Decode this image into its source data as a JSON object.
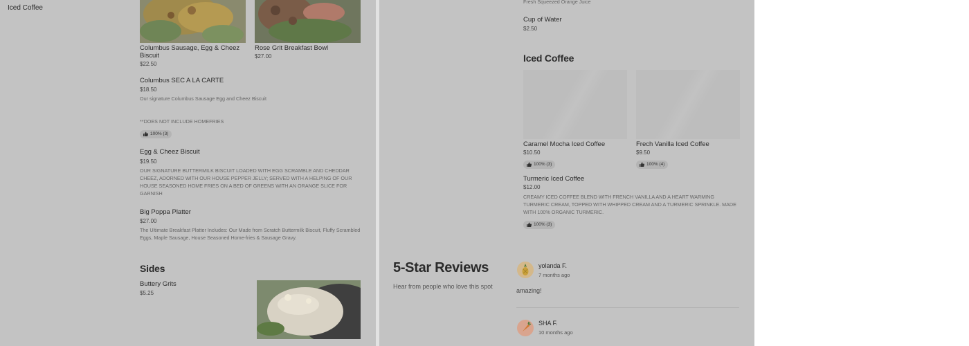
{
  "left_nav": {
    "active_item": "Iced Coffee"
  },
  "menu_left": {
    "items_top": [
      {
        "title": "Columbus Sausage, Egg & Cheez Biscuit",
        "price": "$22.50"
      },
      {
        "title": "Rose Grit Breakfast Bowl",
        "price": "$27.00"
      }
    ],
    "items": [
      {
        "title": "Columbus SEC A LA CARTE",
        "price": "$18.50",
        "desc1": "Our signature Columbus Sausage Egg and Cheez Biscuit",
        "desc2": "**DOES NOT INCLUDE HOMEFRIES",
        "rating": "100% (3)"
      },
      {
        "title": "Egg & Cheez Biscuit",
        "price": "$19.50",
        "desc": "OUR SIGNATURE BUTTERMILK BISCUIT LOADED WITH EGG SCRAMBLE AND CHEDDAR CHEEZ, ADORNED WITH OUR HOUSE PEPPER JELLY; SERVED WITH A HELPING OF OUR HOUSE SEASONED HOME FRIES ON A BED OF GREENS WITH AN ORANGE SLICE FOR GARNISH"
      },
      {
        "title": "Big Poppa Platter",
        "price": "$27.00",
        "desc": "The Ultimate Breakfast Platter Includes: Our Made from Scratch Buttermilk Biscuit, Fluffy Scrambled Eggs, Maple Sausage, House Seasoned Home-fries & Sausage Gravy."
      }
    ],
    "sides": {
      "heading": "Sides",
      "item_title": "Buttery Grits",
      "item_price": "$5.25"
    }
  },
  "menu_right": {
    "top_desc": "Fresh Squeezed Orange Juice",
    "water": {
      "title": "Cup of Water",
      "price": "$2.50"
    },
    "iced_coffee_heading": "Iced Coffee",
    "cards": [
      {
        "title": "Caramel Mocha Iced Coffee",
        "price": "$10.50",
        "rating": "100% (3)"
      },
      {
        "title": "Frech Vanilla Iced Coffee",
        "price": "$9.50",
        "rating": "100% (4)"
      }
    ],
    "turmeric": {
      "title": "Turmeric Iced Coffee",
      "price": "$12.00",
      "desc": "CREAMY ICED COFFEE BLEND WITH FRENCH VANILLA AND A HEART WARMING TURMERIC CREAM, TOPPED WITH WHIPPED CREAM AND A TURMERIC SPRINKLE. MADE WITH 100% ORGANIC TURMERIC.",
      "rating": "100% (3)"
    }
  },
  "reviews": {
    "heading": "5-Star Reviews",
    "subheading": "Hear from people who love this spot",
    "items": [
      {
        "name": "yolanda F.",
        "time": "7 months ago",
        "text": "amazing!"
      },
      {
        "name": "SHA F.",
        "time": "10 months ago"
      }
    ]
  },
  "colors": {
    "overlay": "#c3c3c3",
    "panel_divider": "#e2e2e2"
  }
}
